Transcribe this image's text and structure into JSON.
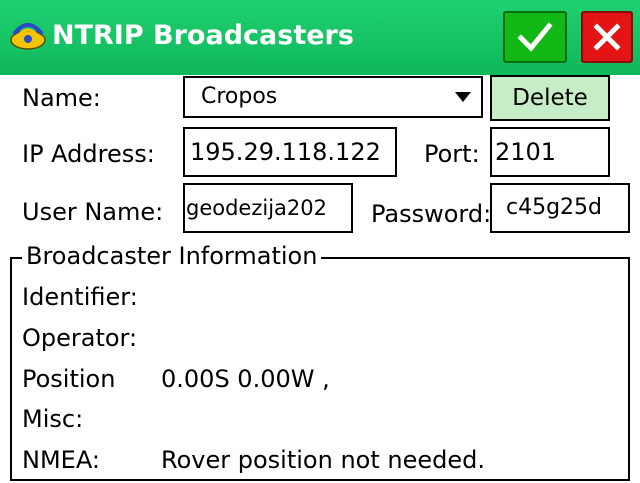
{
  "window": {
    "title": "NTRIP Broadcasters",
    "ok_icon": "checkmark-icon",
    "cancel_icon": "close-icon",
    "titlebar_color": "#14c464",
    "ok_color": "#12b816",
    "cancel_color": "#e21414"
  },
  "form": {
    "name_label": "Name:",
    "name_value": "Cropos",
    "delete_label": "Delete",
    "ip_label": "IP Address:",
    "ip_value": "195.29.118.122",
    "port_label": "Port:",
    "port_value": "2101",
    "user_label": "User Name:",
    "user_value": "geodezija202",
    "password_label": "Password:",
    "password_value": "c45g25d"
  },
  "info": {
    "group_label": "Broadcaster Information",
    "identifier_label": "Identifier:",
    "identifier_value": "",
    "operator_label": "Operator:",
    "operator_value": "",
    "position_label": "Position",
    "position_value": "0.00S 0.00W ,",
    "misc_label": "Misc:",
    "misc_value": "",
    "nmea_label": "NMEA:",
    "nmea_value": "Rover position not needed."
  }
}
